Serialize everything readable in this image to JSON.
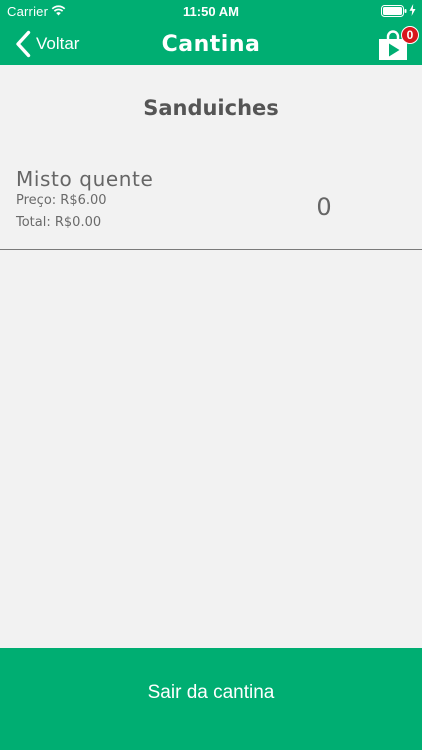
{
  "status_bar": {
    "carrier": "Carrier",
    "time": "11:50 AM",
    "icons": [
      "wifi-icon",
      "battery-icon",
      "charging-bolt-icon"
    ]
  },
  "nav": {
    "back_label": "Voltar",
    "back_icon": "chevron-left-icon",
    "title": "Cantina",
    "cart_icon": "shopping-bag-play-icon",
    "cart_count": "0"
  },
  "section": {
    "title": "Sanduiches"
  },
  "products": [
    {
      "name": "Misto quente",
      "price": "Preço: R$6.00",
      "total": "Total: R$0.00",
      "quantity": "0"
    }
  ],
  "footer": {
    "button_label": "Sair da cantina"
  },
  "colors": {
    "brand_green": "#00ae72",
    "background": "#f2f2f2",
    "badge_red": "#d9161c",
    "text_gray": "#666666"
  }
}
